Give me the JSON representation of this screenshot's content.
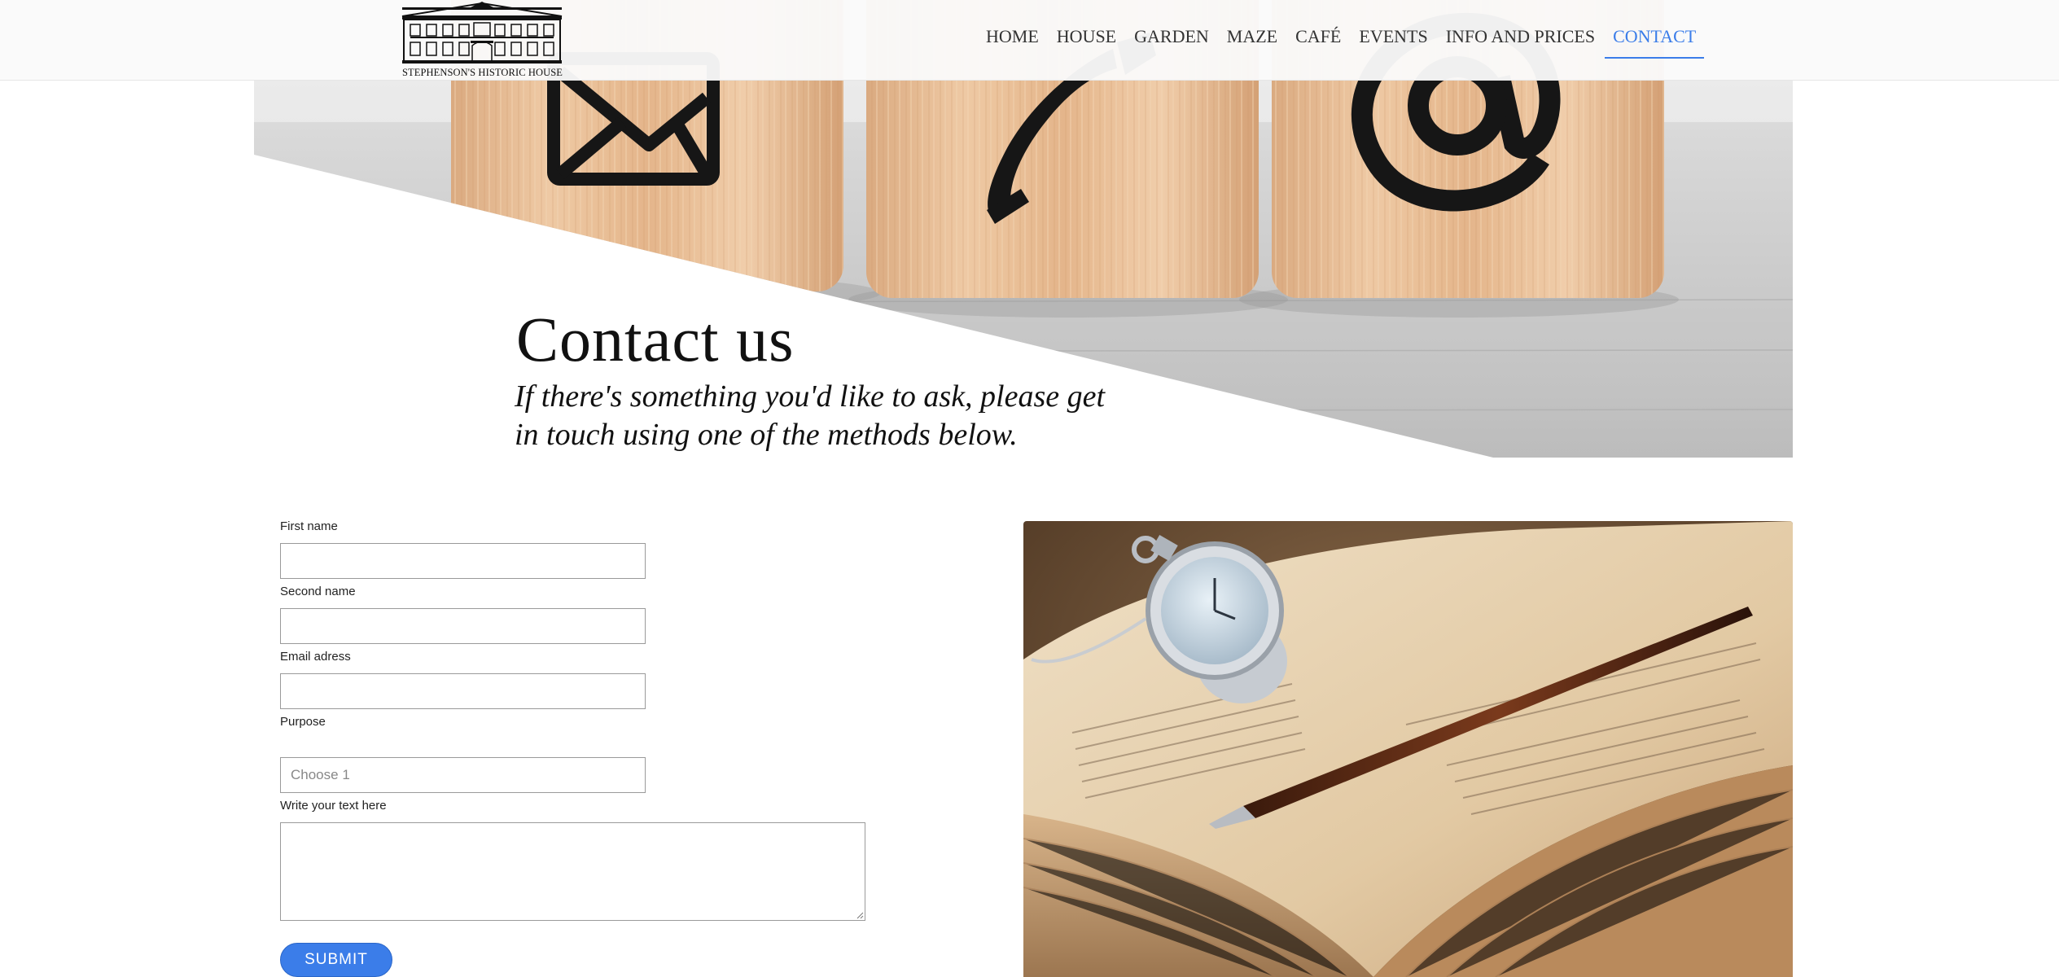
{
  "header": {
    "logo_text": "STEPHENSON'S HISTORIC HOUSE",
    "nav": [
      {
        "label": "HOME"
      },
      {
        "label": "HOUSE"
      },
      {
        "label": "GARDEN"
      },
      {
        "label": "MAZE"
      },
      {
        "label": "CAFÉ"
      },
      {
        "label": "EVENTS"
      },
      {
        "label": "INFO AND PRICES"
      },
      {
        "label": "CONTACT",
        "active": true
      }
    ]
  },
  "hero": {
    "title": "Contact us",
    "subtitle": "If there's something you'd like to ask, please get in touch using one of the methods below.",
    "icons": [
      "envelope-icon",
      "phone-icon",
      "at-sign-icon"
    ]
  },
  "form": {
    "first_name": {
      "label": "First name",
      "value": ""
    },
    "second_name": {
      "label": "Second name",
      "value": ""
    },
    "email": {
      "label": "Email adress",
      "value": ""
    },
    "purpose": {
      "label": "Purpose",
      "selected": "Choose 1"
    },
    "message": {
      "label": "Write your text here",
      "value": ""
    },
    "submit_label": "SUBMIT"
  },
  "colors": {
    "accent": "#3b7de9",
    "text": "#111111",
    "header_bg": "#fafafa"
  }
}
